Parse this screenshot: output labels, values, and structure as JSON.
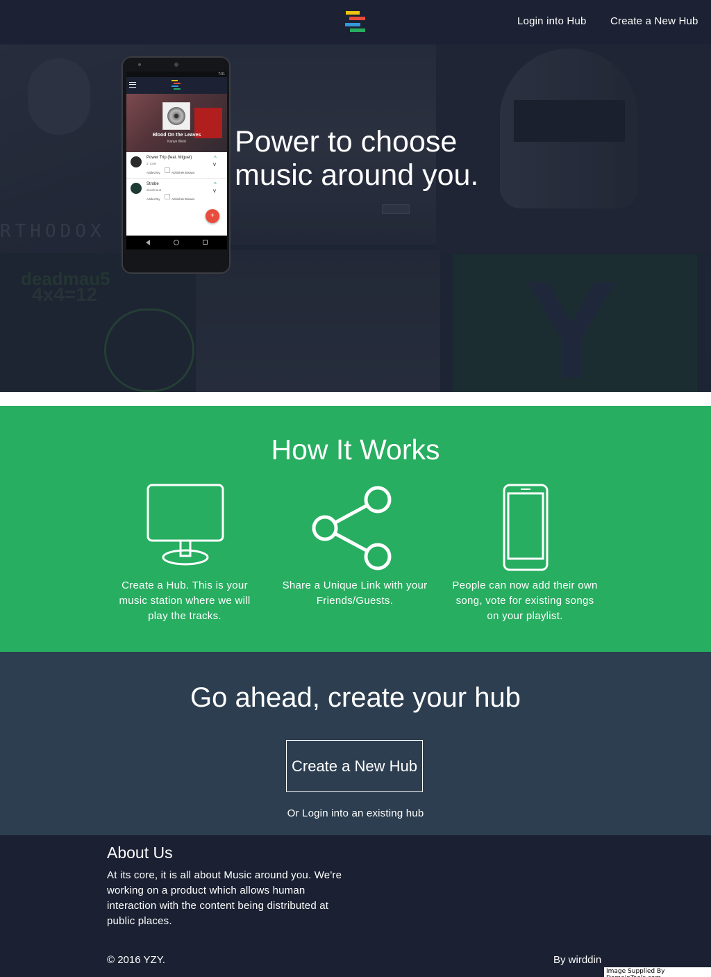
{
  "header": {
    "login_label": "Login into Hub",
    "create_label": "Create a New Hub",
    "logo_colors": [
      "#f1c40f",
      "#e74c3c",
      "#3498db",
      "#27ae60"
    ]
  },
  "hero": {
    "title": "Power to choose music around you.",
    "background_tiles": [
      "deadmau5 4x4=12"
    ],
    "tile_text": {
      "orthodox": "RTHODOX JU",
      "deadmau5": "deadmau5",
      "album": "4x4=12"
    },
    "phone": {
      "status_time": "7:01",
      "now_playing": {
        "title": "Blood On the Leaves",
        "artist": "Kanye West"
      },
      "tracks": [
        {
          "title": "Power Trip (feat. Miguel)",
          "artist": "J. Cole",
          "added_by_label": "Added By",
          "added_by": "Abhishek Biswal"
        },
        {
          "title": "Strobe",
          "artist": "deadmau5",
          "added_by_label": "Added By",
          "added_by": "Abhishek Biswal"
        }
      ],
      "fab_label": "+"
    }
  },
  "how": {
    "title": "How It Works",
    "steps": [
      {
        "icon": "monitor-icon",
        "text": "Create a Hub. This is your music station where we will play the tracks."
      },
      {
        "icon": "share-icon",
        "text": "Share a Unique Link with your Friends/Guests."
      },
      {
        "icon": "smartphone-icon",
        "text": "People can now add their own song, vote for existing songs on your playlist."
      }
    ]
  },
  "cta": {
    "title": "Go ahead, create your hub",
    "button_label": "Create a New Hub",
    "sub_link": "Or Login into an existing hub"
  },
  "footer": {
    "about_title": "About Us",
    "about_text": "At its core, it is all about Music around you. We're working on a product which allows human interaction with the content being distributed at public places.",
    "copyright": "© 2016 YZY.",
    "byline": "By wirddin",
    "watermark": "Image Supplied By DomainTools.com"
  },
  "colors": {
    "green": "#27ae60",
    "slate": "#2c3e50",
    "navy": "#1b2132",
    "fab_red": "#e74c3c"
  }
}
